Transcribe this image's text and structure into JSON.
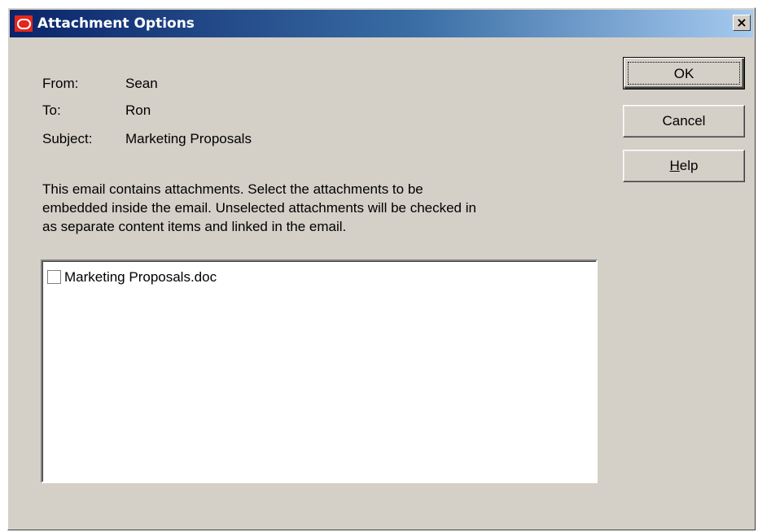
{
  "window": {
    "title": "Attachment Options",
    "close_glyph": "×",
    "app_icon": "oracle-logo-icon"
  },
  "fields": {
    "from_label": "From:",
    "from_value": "Sean",
    "to_label": "To:",
    "to_value": "Ron",
    "subject_label": "Subject:",
    "subject_value": "Marketing Proposals"
  },
  "message": "This email contains attachments. Select the attachments to be\nembedded inside the email. Unselected attachments will be checked in\nas separate content items and linked in the email.",
  "attachments": [
    {
      "name": "Marketing Proposals.doc",
      "checked": false
    }
  ],
  "buttons": {
    "ok": "OK",
    "cancel": "Cancel",
    "help_prefix": "H",
    "help_rest": "elp"
  },
  "colors": {
    "title_gradient_start": "#0a246a",
    "title_gradient_end": "#a6caf0",
    "dialog_face": "#d4d0c8",
    "icon_red": "#e4261b"
  }
}
